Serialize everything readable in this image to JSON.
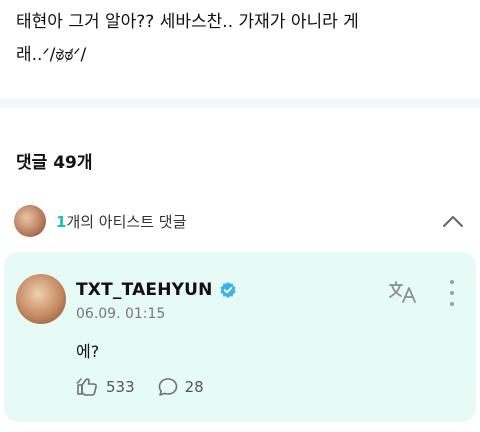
{
  "post": {
    "line1": "태현아 그거 알아?? 세바스찬.. 가재가 아니라 게",
    "line2": "래..ᐟ/ಠ̷̀ಠ̷́ᐟ/"
  },
  "comments": {
    "title": "댓글 49개"
  },
  "artist_comments": {
    "count": "1",
    "label": "개의 아티스트 댓글"
  },
  "comment": {
    "author": "TXT_TAEHYUN",
    "time": "06.09. 01:15",
    "text": "에?",
    "likes": "533",
    "replies": "28"
  },
  "colors": {
    "accent": "#12c3b6",
    "card_bg": "#e6faf6",
    "verified": "#3fb2ea"
  },
  "icons": [
    "chevron-up-icon",
    "verified-badge-icon",
    "translate-icon",
    "more-vertical-icon",
    "like-icon",
    "reply-icon"
  ]
}
